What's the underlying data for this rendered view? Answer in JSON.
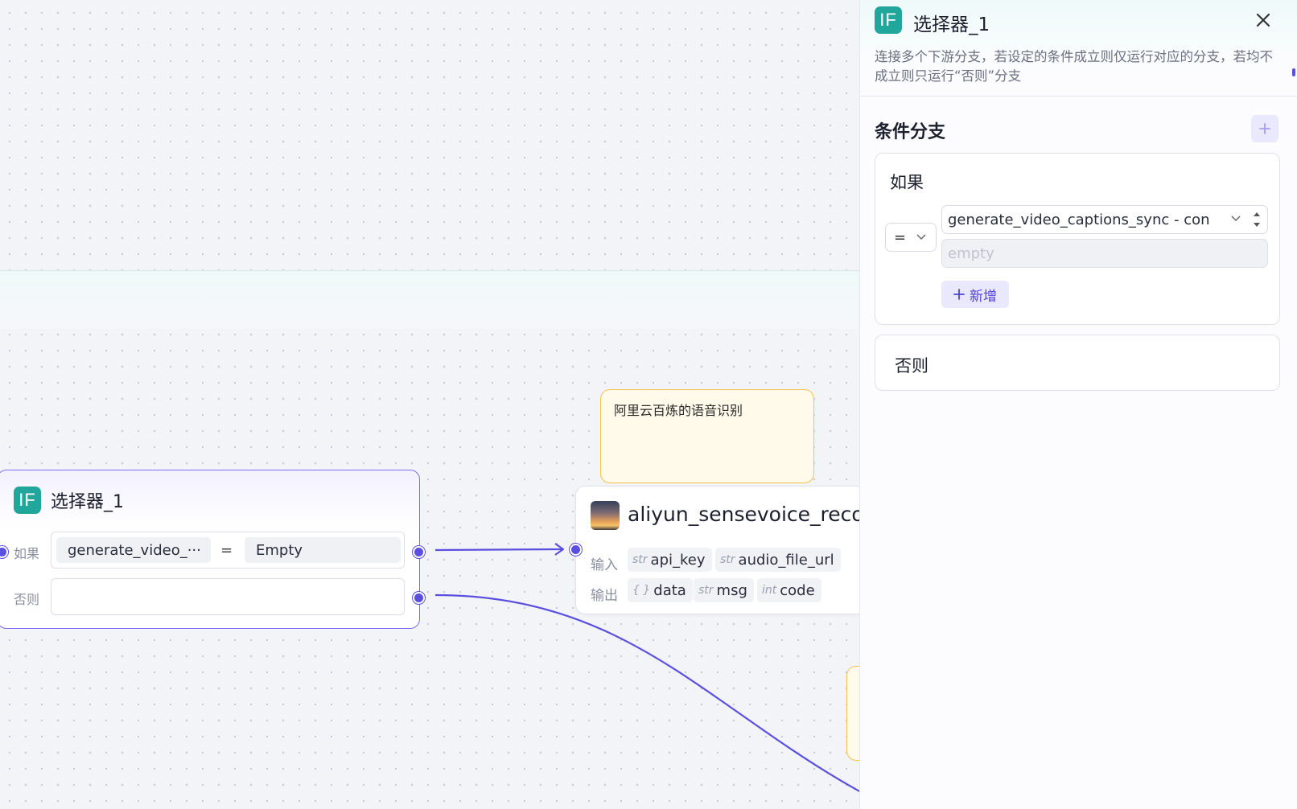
{
  "selector_node": {
    "badge": "IF",
    "title": "选择器_1",
    "if_label": "如果",
    "else_label": "否则",
    "condition_var": "generate_video_···",
    "condition_op": "=",
    "condition_value": "Empty"
  },
  "note": {
    "text": "阿里云百炼的语音识别"
  },
  "aliyun_node": {
    "title": "aliyun_sensevoice_recognition",
    "input_label": "输入",
    "output_label": "输出",
    "inputs": [
      {
        "type": "str",
        "name": "api_key"
      },
      {
        "type": "str",
        "name": "audio_file_url"
      }
    ],
    "outputs": [
      {
        "type": "{ }",
        "name": "data"
      },
      {
        "type": "str",
        "name": "msg"
      },
      {
        "type": "int",
        "name": "code"
      }
    ]
  },
  "panel": {
    "badge": "IF",
    "title": "选择器_1",
    "description": "连接多个下游分支，若设定的条件成立则仅运行对应的分支，若均不成立则只运行“否则”分支",
    "section_title": "条件分支",
    "if_label": "如果",
    "operator": "=",
    "variable": "generate_video_captions_sync - content",
    "value_placeholder": "empty",
    "add_label": "新增",
    "else_label": "否则"
  },
  "colors": {
    "accent": "#5b4fe0",
    "if_badge": "#21a69c",
    "note_border": "#f4c24d",
    "note_bg": "#fffaea"
  },
  "icons": [
    "if-badge-icon",
    "close-icon",
    "plus-icon",
    "chevron-down-icon",
    "spinner-arrows-icon",
    "node-thumbnail-icon"
  ]
}
